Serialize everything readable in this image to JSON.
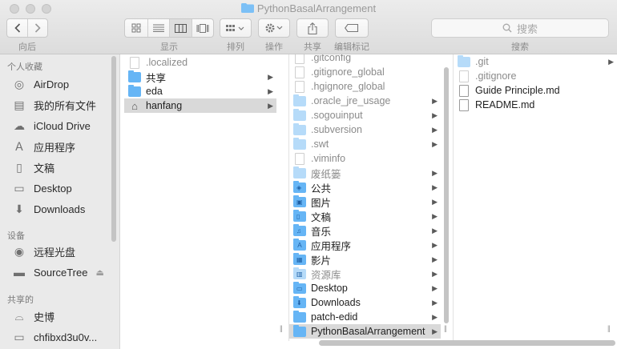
{
  "window": {
    "title": "PythonBasalArrangement"
  },
  "toolbar": {
    "back_forward_label": "向后",
    "view_label": "显示",
    "arrange_label": "排列",
    "action_label": "操作",
    "share_label": "共享",
    "tags_label": "编辑标记",
    "search_placeholder": "搜索",
    "search_label": "搜索"
  },
  "sidebar": {
    "favorites_header": "个人收藏",
    "devices_header": "设备",
    "shared_header": "共享的",
    "favorites": [
      {
        "label": "AirDrop",
        "icon": "airdrop-icon"
      },
      {
        "label": "我的所有文件",
        "icon": "all-files-icon"
      },
      {
        "label": "iCloud Drive",
        "icon": "cloud-icon"
      },
      {
        "label": "应用程序",
        "icon": "applications-icon"
      },
      {
        "label": "文稿",
        "icon": "documents-icon"
      },
      {
        "label": "Desktop",
        "icon": "desktop-icon"
      },
      {
        "label": "Downloads",
        "icon": "downloads-icon"
      }
    ],
    "devices": [
      {
        "label": "远程光盘",
        "icon": "disc-icon"
      },
      {
        "label": "SourceTree",
        "icon": "disk-icon"
      }
    ],
    "shared": [
      {
        "label": "史博",
        "icon": "network-icon"
      },
      {
        "label": "chfibxd3u0v...",
        "icon": "computer-icon"
      }
    ]
  },
  "columns": {
    "col1": [
      {
        "name": ".localized",
        "type": "file",
        "hidden": true
      },
      {
        "name": "共享",
        "type": "folder",
        "arrow": true
      },
      {
        "name": "eda",
        "type": "folder",
        "arrow": true
      },
      {
        "name": "hanfang",
        "type": "home",
        "arrow": true,
        "selected": true
      }
    ],
    "col2": [
      {
        "name": ".gitconfig",
        "type": "file",
        "hidden": true
      },
      {
        "name": ".gitignore_global",
        "type": "file",
        "hidden": true
      },
      {
        "name": ".hgignore_global",
        "type": "file",
        "hidden": true
      },
      {
        "name": ".oracle_jre_usage",
        "type": "folder",
        "hidden": true,
        "arrow": true
      },
      {
        "name": ".sogouinput",
        "type": "folder",
        "hidden": true,
        "arrow": true
      },
      {
        "name": ".subversion",
        "type": "folder",
        "hidden": true,
        "arrow": true
      },
      {
        "name": ".swt",
        "type": "folder",
        "hidden": true,
        "arrow": true
      },
      {
        "name": ".viminfo",
        "type": "file",
        "hidden": true
      },
      {
        "name": "废纸篓",
        "type": "folder",
        "hidden": true,
        "arrow": true
      },
      {
        "name": "公共",
        "type": "folder",
        "arrow": true
      },
      {
        "name": "图片",
        "type": "folder",
        "arrow": true
      },
      {
        "name": "文稿",
        "type": "folder",
        "arrow": true
      },
      {
        "name": "音乐",
        "type": "folder",
        "arrow": true
      },
      {
        "name": "应用程序",
        "type": "folder",
        "arrow": true
      },
      {
        "name": "影片",
        "type": "folder",
        "arrow": true
      },
      {
        "name": "资源库",
        "type": "folder",
        "hidden": true,
        "arrow": true
      },
      {
        "name": "Desktop",
        "type": "folder",
        "arrow": true
      },
      {
        "name": "Downloads",
        "type": "folder",
        "arrow": true
      },
      {
        "name": "patch-edid",
        "type": "folder",
        "arrow": true
      },
      {
        "name": "PythonBasalArrangement",
        "type": "folder",
        "arrow": true,
        "selected": true
      }
    ],
    "col3": [
      {
        "name": ".git",
        "type": "folder",
        "hidden": true,
        "arrow": true
      },
      {
        "name": ".gitignore",
        "type": "file",
        "hidden": true
      },
      {
        "name": "Guide Principle.md",
        "type": "file"
      },
      {
        "name": "README.md",
        "type": "file"
      }
    ]
  }
}
